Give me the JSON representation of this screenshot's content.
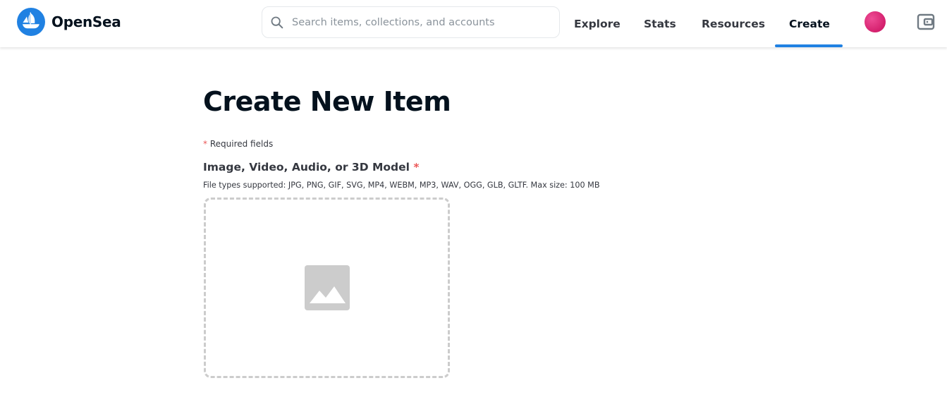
{
  "header": {
    "brand_name": "OpenSea",
    "search": {
      "placeholder": "Search items, collections, and accounts",
      "value": ""
    },
    "nav": [
      {
        "label": "Explore",
        "active": false
      },
      {
        "label": "Stats",
        "active": false
      },
      {
        "label": "Resources",
        "active": false
      },
      {
        "label": "Create",
        "active": true
      }
    ],
    "icons": {
      "logo": "opensea-logo-icon",
      "search": "search-icon",
      "avatar": "avatar",
      "wallet": "wallet-icon"
    }
  },
  "main": {
    "title": "Create New Item",
    "required_note": {
      "asterisk": "*",
      "text": "Required fields"
    },
    "media_field": {
      "label": "Image, Video, Audio, or 3D Model",
      "required_asterisk": "*",
      "help_text": "File types supported: JPG, PNG, GIF, SVG, MP4, WEBM, MP3, WAV, OGG, GLB, GLTF. Max size: 100 MB",
      "dropzone_icon": "image-icon"
    }
  },
  "colors": {
    "brand_blue": "#2081e2",
    "text_primary": "#04111d",
    "text_secondary": "#353840",
    "required_red": "#eb5757",
    "dropzone_border": "#cccccc",
    "placeholder_icon": "#cccccc",
    "avatar_pink": "#e23a86"
  }
}
